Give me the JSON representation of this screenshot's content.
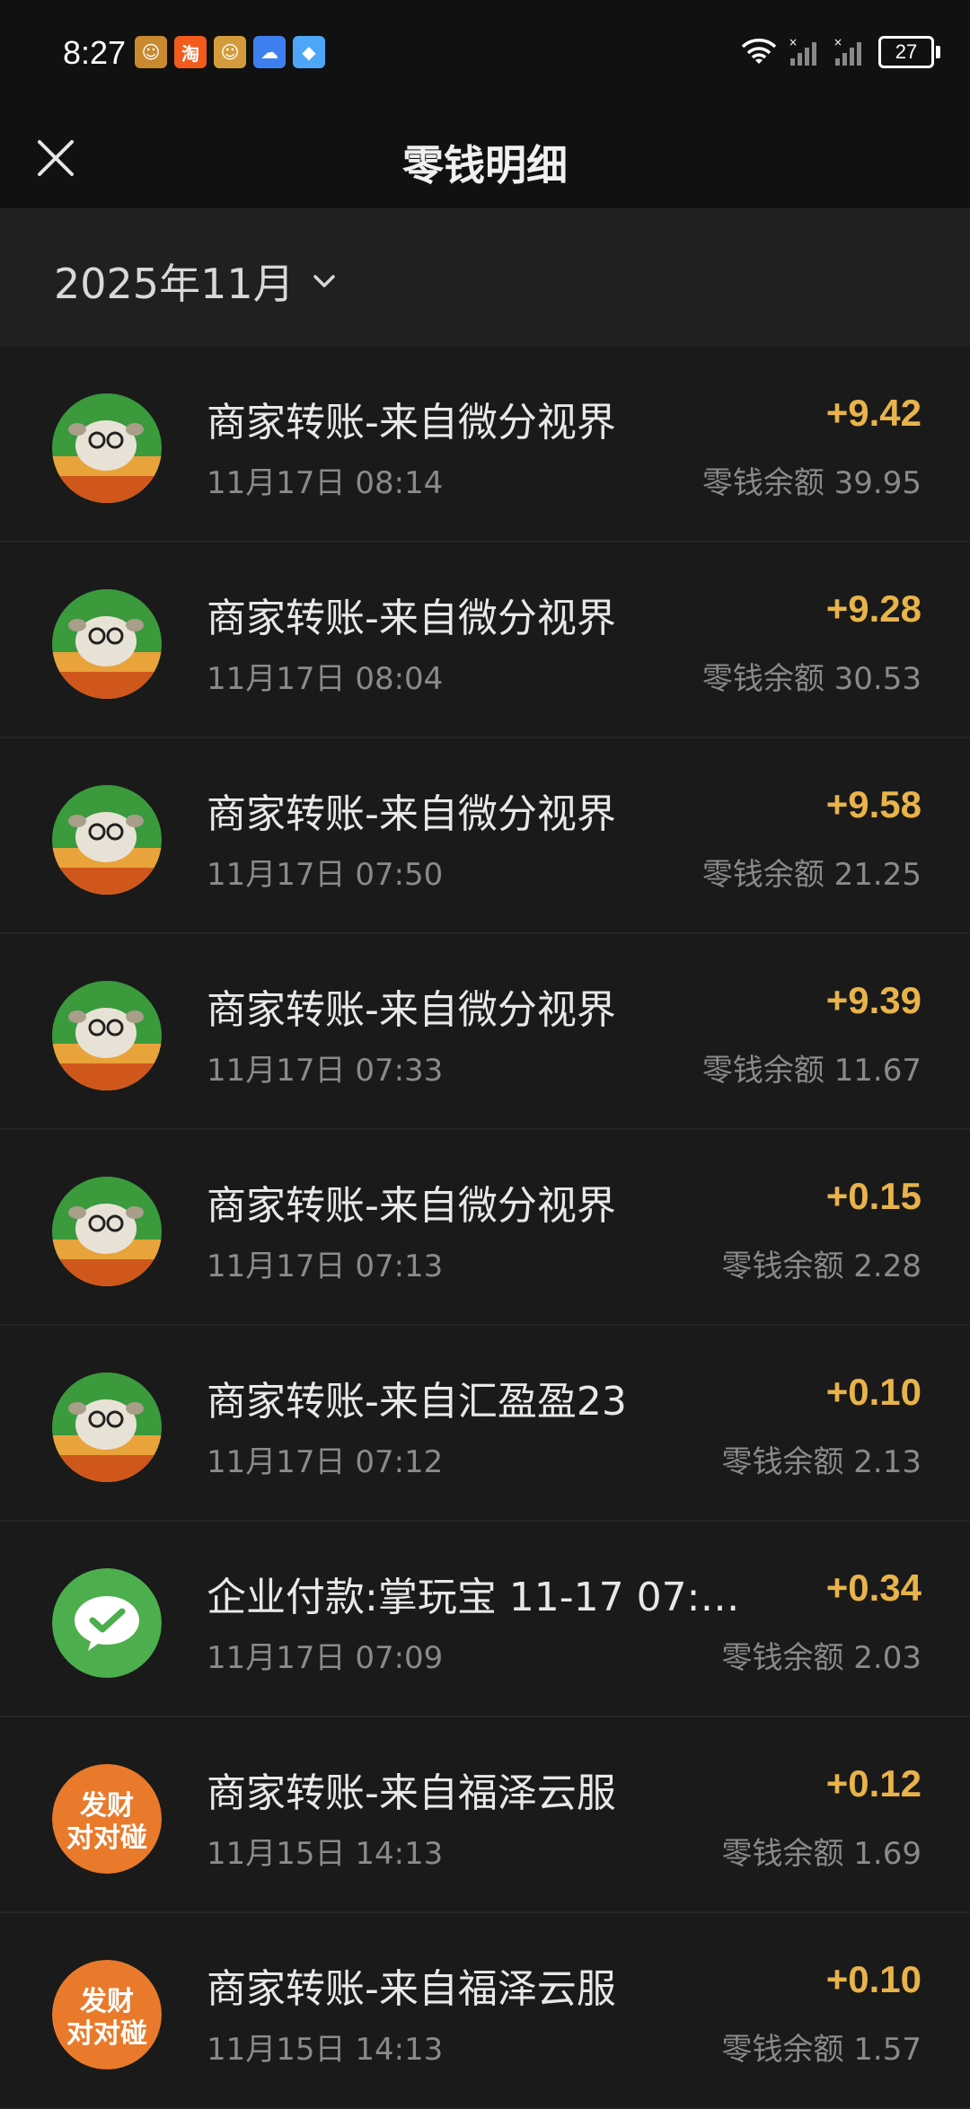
{
  "status_bar": {
    "time": "8:27",
    "battery": "27",
    "notification_icons": [
      "game-app-icon",
      "taobao-icon",
      "game-app-icon",
      "weather-icon",
      "browser-icon"
    ]
  },
  "header": {
    "title": "零钱明细"
  },
  "month_filter": {
    "label": "2025年11月"
  },
  "colors": {
    "amount": "#e8b34a",
    "background": "#191919"
  },
  "transactions": [
    {
      "title": "商家转账-来自微分视界",
      "date": "11月17日 08:14",
      "amount": "+9.42",
      "balance": "零钱余额 39.95",
      "avatar": "sheep"
    },
    {
      "title": "商家转账-来自微分视界",
      "date": "11月17日 08:04",
      "amount": "+9.28",
      "balance": "零钱余额 30.53",
      "avatar": "sheep"
    },
    {
      "title": "商家转账-来自微分视界",
      "date": "11月17日 07:50",
      "amount": "+9.58",
      "balance": "零钱余额 21.25",
      "avatar": "sheep"
    },
    {
      "title": "商家转账-来自微分视界",
      "date": "11月17日 07:33",
      "amount": "+9.39",
      "balance": "零钱余额 11.67",
      "avatar": "sheep"
    },
    {
      "title": "商家转账-来自微分视界",
      "date": "11月17日 07:13",
      "amount": "+0.15",
      "balance": "零钱余额 2.28",
      "avatar": "sheep"
    },
    {
      "title": "商家转账-来自汇盈盈23",
      "date": "11月17日 07:12",
      "amount": "+0.10",
      "balance": "零钱余额 2.13",
      "avatar": "sheep"
    },
    {
      "title": "企业付款:掌玩宝 11-17 07:0...",
      "date": "11月17日 07:09",
      "amount": "+0.34",
      "balance": "零钱余额 2.03",
      "avatar": "wechat"
    },
    {
      "title": "商家转账-来自福泽云服",
      "date": "11月15日 14:13",
      "amount": "+0.12",
      "balance": "零钱余额 1.69",
      "avatar": "facai",
      "avatar_text": [
        "发财",
        "对对碰"
      ]
    },
    {
      "title": "商家转账-来自福泽云服",
      "date": "11月15日 14:13",
      "amount": "+0.10",
      "balance": "零钱余额 1.57",
      "avatar": "facai",
      "avatar_text": [
        "发财",
        "对对碰"
      ]
    }
  ]
}
